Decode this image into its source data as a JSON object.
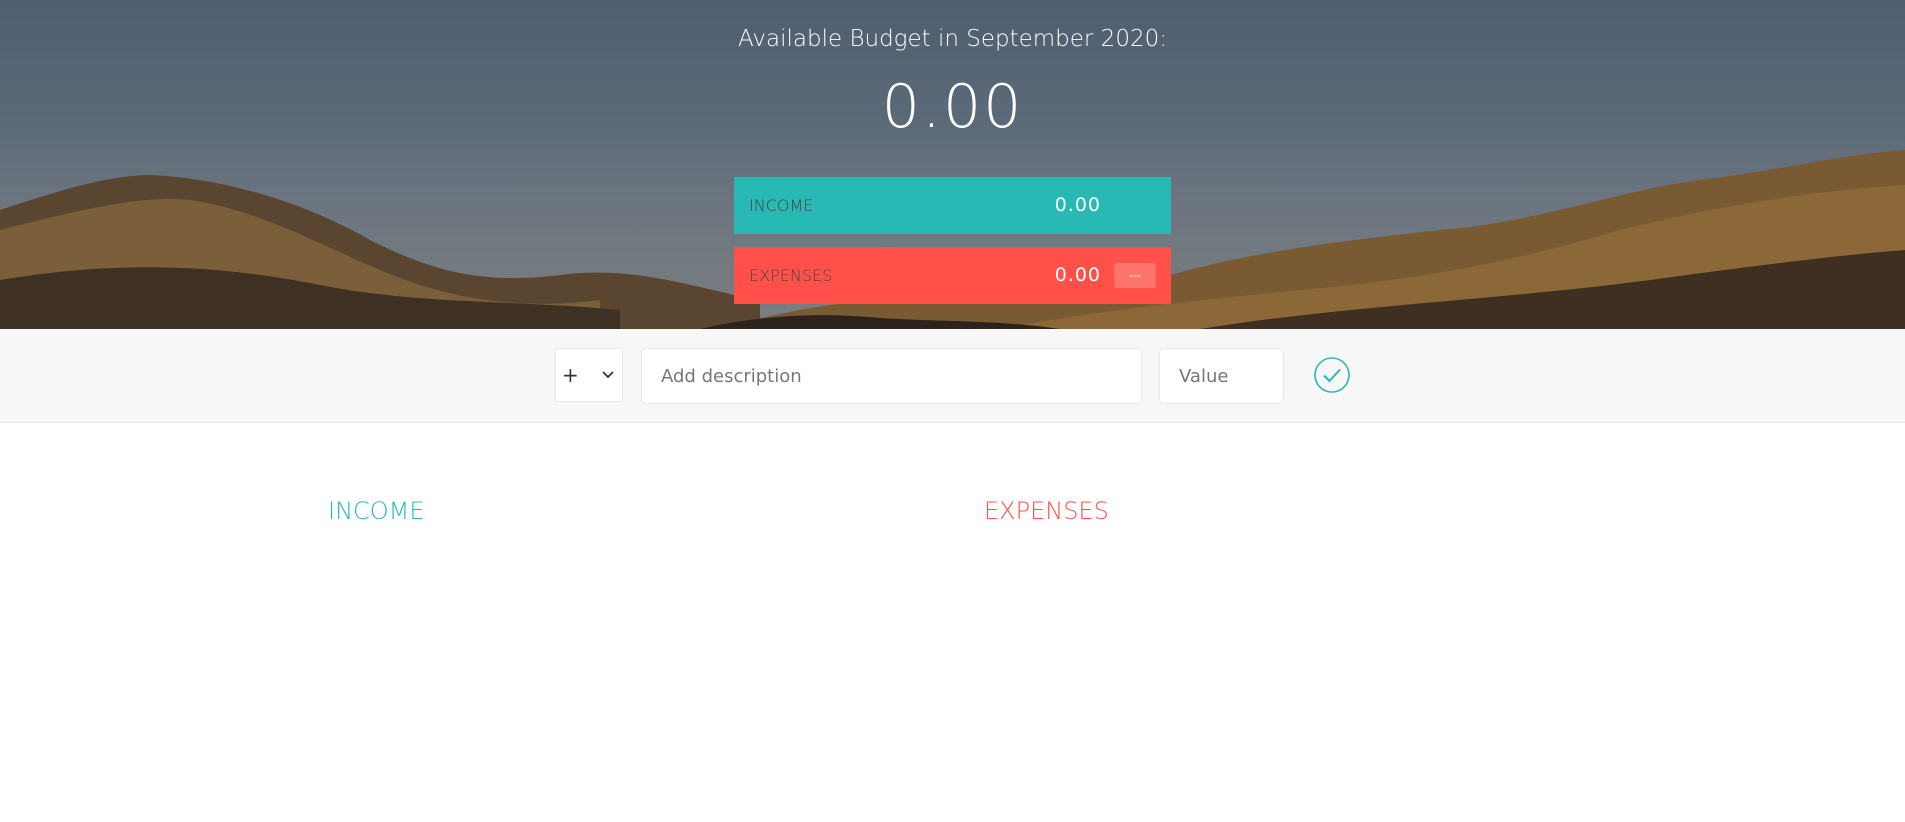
{
  "header": {
    "title": "Available Budget in September 2020:",
    "budget_value": "0.00"
  },
  "summary": {
    "income": {
      "label": "INCOME",
      "value": "0.00"
    },
    "expenses": {
      "label": "EXPENSES",
      "value": "0.00",
      "percentage": "---"
    }
  },
  "add_form": {
    "type_selected": "+",
    "description_placeholder": "Add description",
    "value_placeholder": "Value",
    "submit_icon": "check-circle-icon"
  },
  "lists": {
    "income_title": "INCOME",
    "expenses_title": "EXPENSES"
  },
  "colors": {
    "income": "#28b9b5",
    "expenses": "#ff5049",
    "form_bg": "#f7f7f7"
  }
}
